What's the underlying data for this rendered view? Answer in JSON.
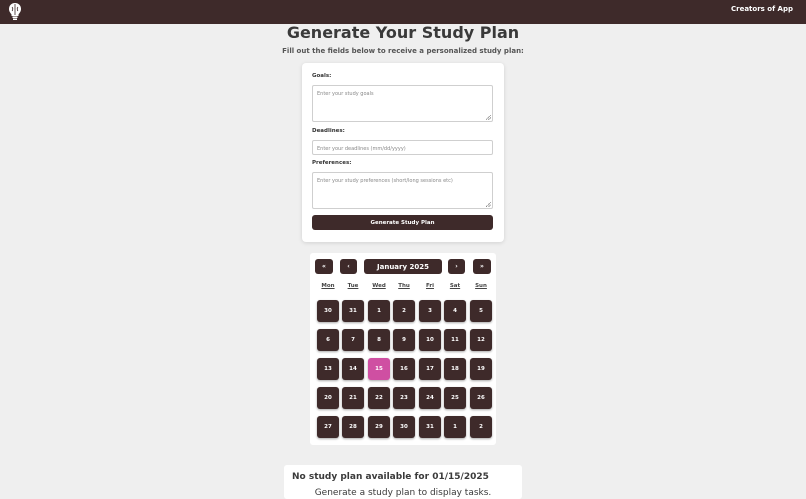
{
  "navbar": {
    "logo_icon": "brain-lightbulb-icon",
    "link_label": "Creators of App",
    "background": "#3e2a2a"
  },
  "header": {
    "title": "Generate Your Study Plan",
    "subtitle": "Fill out the fields below to receive a personalized study plan:"
  },
  "form": {
    "goals": {
      "label": "Goals:",
      "placeholder": "Enter your study goals"
    },
    "deadlines": {
      "label": "Deadlines:",
      "placeholder": "Enter your deadlines (mm/dd/yyyy)"
    },
    "preferences": {
      "label": "Preferences:",
      "placeholder": "Enter your study preferences (short/long sessions etc)"
    },
    "submit_label": "Generate Study Plan"
  },
  "calendar": {
    "prev_year": "«",
    "prev_month": "‹",
    "month_label": "January 2025",
    "next_month": "›",
    "next_year": "»",
    "weekdays": [
      "Mon",
      "Tue",
      "Wed",
      "Thu",
      "Fri",
      "Sat",
      "Sun"
    ],
    "weeks": [
      [
        "30",
        "31",
        "1",
        "2",
        "3",
        "4",
        "5"
      ],
      [
        "6",
        "7",
        "8",
        "9",
        "10",
        "11",
        "12"
      ],
      [
        "13",
        "14",
        "15",
        "16",
        "17",
        "18",
        "19"
      ],
      [
        "20",
        "21",
        "22",
        "23",
        "24",
        "25",
        "26"
      ],
      [
        "27",
        "28",
        "29",
        "30",
        "31",
        "1",
        "2"
      ]
    ],
    "selected_day": "15",
    "selected_color": "#cf4fa2",
    "day_color": "#3e2a2a"
  },
  "plan": {
    "title": "No study plan available for 01/15/2025",
    "note": "Generate a study plan to display tasks."
  }
}
